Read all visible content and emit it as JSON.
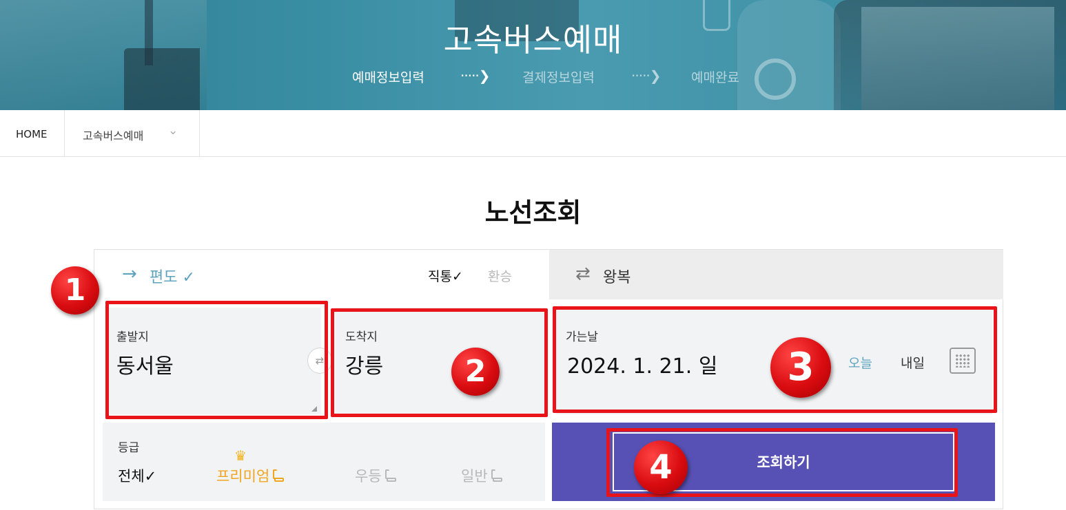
{
  "hero": {
    "title": "고속버스예매",
    "steps": [
      "예매정보입력",
      "결제정보입력",
      "예매완료"
    ],
    "arrow": "·····❯"
  },
  "breadcrumb": {
    "home": "HOME",
    "current": "고속버스예매"
  },
  "page_title": "노선조회",
  "trip_tabs": {
    "oneway_arrow": "→",
    "oneway": "편도 ✓",
    "roundtrip_arrow": "⇄",
    "roundtrip": "왕복"
  },
  "route_type": {
    "direct": "직통✓",
    "transfer": "환승"
  },
  "departure": {
    "label": "출발지",
    "value": "동서울"
  },
  "arrival": {
    "label": "도착지",
    "value": "강릉"
  },
  "date": {
    "label": "가는날",
    "value": "2024. 1. 21. 일",
    "today": "오늘",
    "tomorrow": "내일"
  },
  "grade": {
    "label": "등급",
    "options": [
      "전체✓",
      "프리미엄",
      "우등",
      "일반"
    ],
    "selected": "전체"
  },
  "search_button": "조회하기",
  "annotations": [
    "1",
    "2",
    "3",
    "4"
  ],
  "colors": {
    "hero_bg": "#3a8ea3",
    "accent_blue": "#5da3be",
    "premium": "#f1a51f",
    "search_bg": "#5851b5",
    "highlight_red": "#e8141a"
  }
}
